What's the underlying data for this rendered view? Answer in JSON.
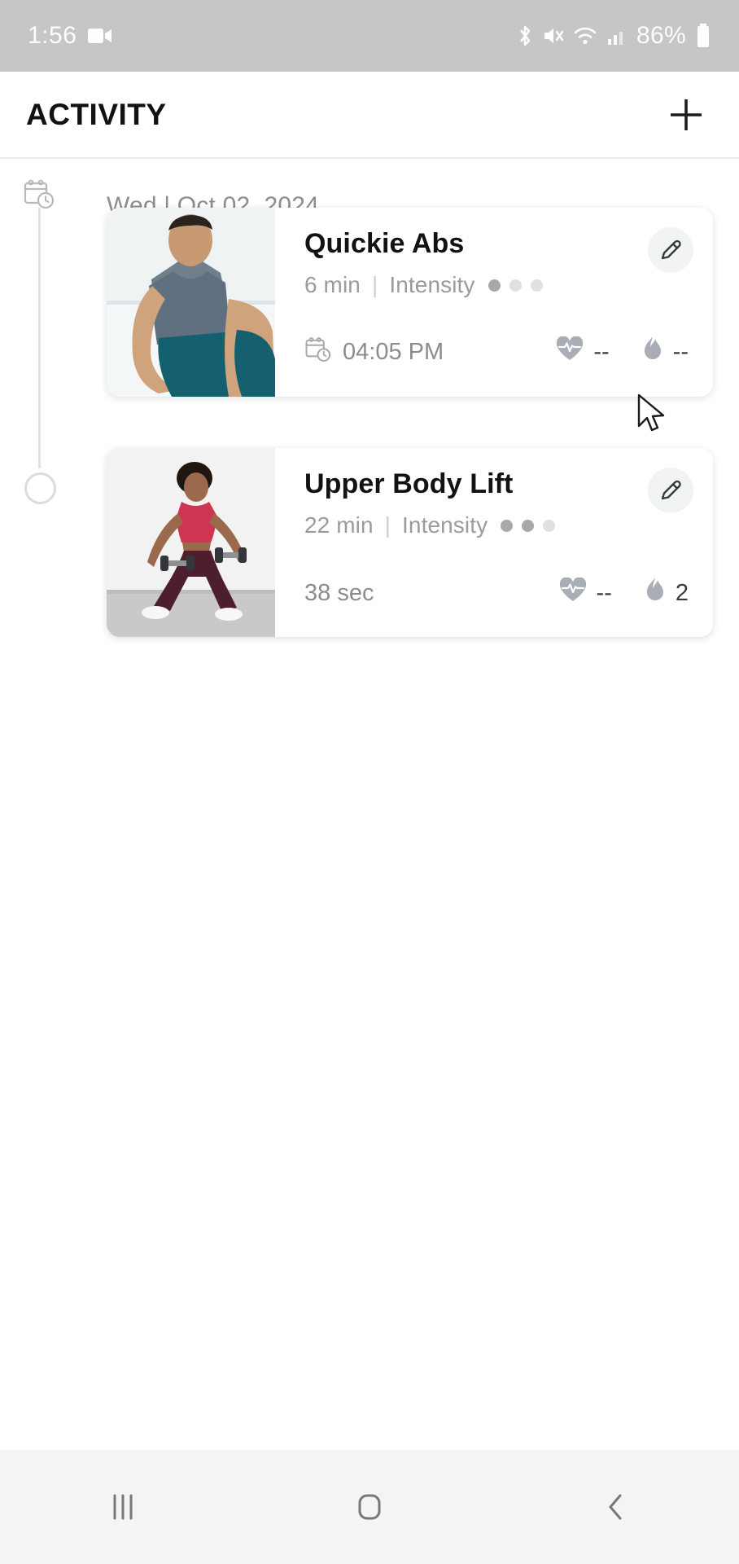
{
  "status_bar": {
    "time": "1:56",
    "battery_text": "86%",
    "icons": [
      "video-camera-icon",
      "bluetooth-icon",
      "mute-icon",
      "wifi-icon",
      "cellular-signal-icon",
      "battery-icon"
    ]
  },
  "header": {
    "title": "ACTIVITY",
    "add_label": "+"
  },
  "timeline": {
    "date_label": "Wed | Oct 02, 2024"
  },
  "cards": [
    {
      "title": "Quickie Abs",
      "duration": "6 min",
      "separator": "|",
      "intensity_label": "Intensity",
      "intensity_filled": 1,
      "intensity_total": 3,
      "time_value": "04:05 PM",
      "has_time_icon": true,
      "heart_rate": "--",
      "calories": "--",
      "thumb_alt": "man-doing-abs-exercise",
      "edit_label": "edit"
    },
    {
      "title": "Upper Body Lift",
      "duration": "22 min",
      "separator": "|",
      "intensity_label": "Intensity",
      "intensity_filled": 2,
      "intensity_total": 3,
      "time_value": "38 sec",
      "has_time_icon": false,
      "heart_rate": "--",
      "calories": "2",
      "thumb_alt": "woman-lifting-dumbbells",
      "edit_label": "edit"
    }
  ],
  "nav_bar": {
    "recents_label": "recents",
    "home_label": "home",
    "back_label": "back"
  },
  "colors": {
    "status_bg": "#c6c6c6",
    "header_text": "#111111",
    "muted_text": "#9b9b9b",
    "card_bg": "#ffffff",
    "nav_bg": "#f4f4f4",
    "rail_line": "#e3e3e3"
  }
}
